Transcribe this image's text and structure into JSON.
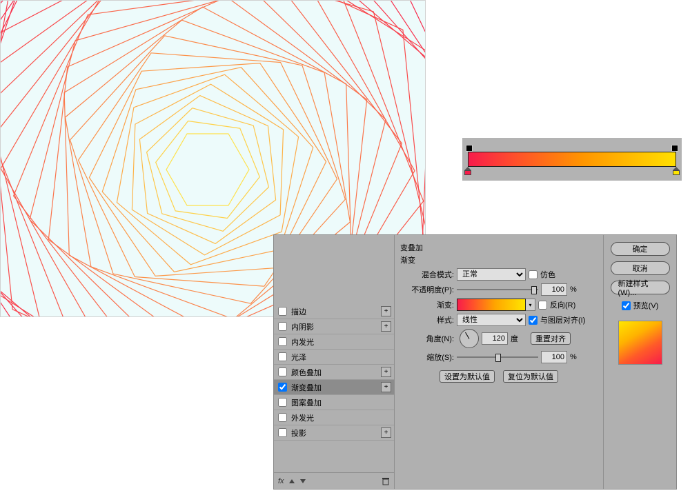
{
  "gradient": {
    "stops": [
      "#f71c4b",
      "#ffe600"
    ],
    "angle": 120
  },
  "fxList": {
    "items": [
      {
        "label": "描边",
        "checked": false,
        "sel": false,
        "plus": true
      },
      {
        "label": "内阴影",
        "checked": false,
        "sel": false,
        "plus": true
      },
      {
        "label": "内发光",
        "checked": false,
        "sel": false,
        "plus": false
      },
      {
        "label": "光泽",
        "checked": false,
        "sel": false,
        "plus": false
      },
      {
        "label": "颜色叠加",
        "checked": false,
        "sel": false,
        "plus": true
      },
      {
        "label": "渐变叠加",
        "checked": true,
        "sel": true,
        "plus": true
      },
      {
        "label": "图案叠加",
        "checked": false,
        "sel": false,
        "plus": false
      },
      {
        "label": "外发光",
        "checked": false,
        "sel": false,
        "plus": false
      },
      {
        "label": "投影",
        "checked": false,
        "sel": false,
        "plus": true
      }
    ]
  },
  "panel": {
    "sectionTitle": "变叠加",
    "subTitle": "渐变",
    "blend": {
      "label": "混合模式:",
      "value": "正常"
    },
    "dither": {
      "label": "仿色",
      "checked": false
    },
    "opacity": {
      "label": "不透明度(P):",
      "value": "100",
      "unit": "%"
    },
    "grad": {
      "label": "渐变:"
    },
    "reverse": {
      "label": "反向(R)",
      "checked": false
    },
    "style": {
      "label": "样式:",
      "value": "线性"
    },
    "alignLayer": {
      "label": "与图层对齐(I)",
      "checked": true
    },
    "angle": {
      "label": "角度(N):",
      "value": "120",
      "unit": "度",
      "resetLabel": "重置对齐"
    },
    "scale": {
      "label": "缩放(S):",
      "value": "100",
      "unit": "%"
    },
    "setDefault": "设置为默认值",
    "resetDefault": "复位为默认值"
  },
  "right": {
    "ok": "确定",
    "cancel": "取消",
    "newStyle": "新建样式(W)...",
    "preview": "预览(V)",
    "previewChecked": true
  }
}
